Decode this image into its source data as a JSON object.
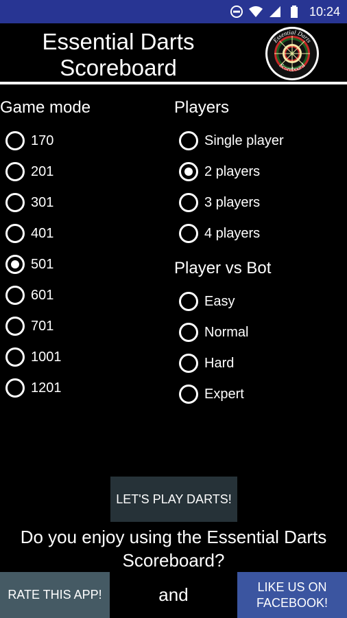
{
  "status_bar": {
    "time": "10:24"
  },
  "header": {
    "title": "Essential Darts Scoreboard",
    "logo_text_top": "Essential Darts",
    "logo_text_bottom": "Scoreboard"
  },
  "game_mode": {
    "title": "Game mode",
    "options": [
      "170",
      "201",
      "301",
      "401",
      "501",
      "601",
      "701",
      "1001",
      "1201"
    ],
    "selected": "501"
  },
  "players": {
    "title": "Players",
    "options": [
      "Single player",
      "2 players",
      "3 players",
      "4 players"
    ],
    "selected": "2 players"
  },
  "bot": {
    "title": "Player vs Bot",
    "options": [
      "Easy",
      "Normal",
      "Hard",
      "Expert"
    ],
    "selected": ""
  },
  "play_button": "LET'S PLAY DARTS!",
  "enjoy_text": "Do you enjoy using the Essential Darts Scoreboard?",
  "rate_button": "RATE THIS APP!",
  "and_text": "and",
  "facebook_button": "LIKE US ON FACEBOOK!",
  "colors": {
    "status_bar": "#283593",
    "background": "#000000",
    "play_button": "#263238",
    "rate_button": "#455a64",
    "facebook_button": "#3b55a0"
  }
}
